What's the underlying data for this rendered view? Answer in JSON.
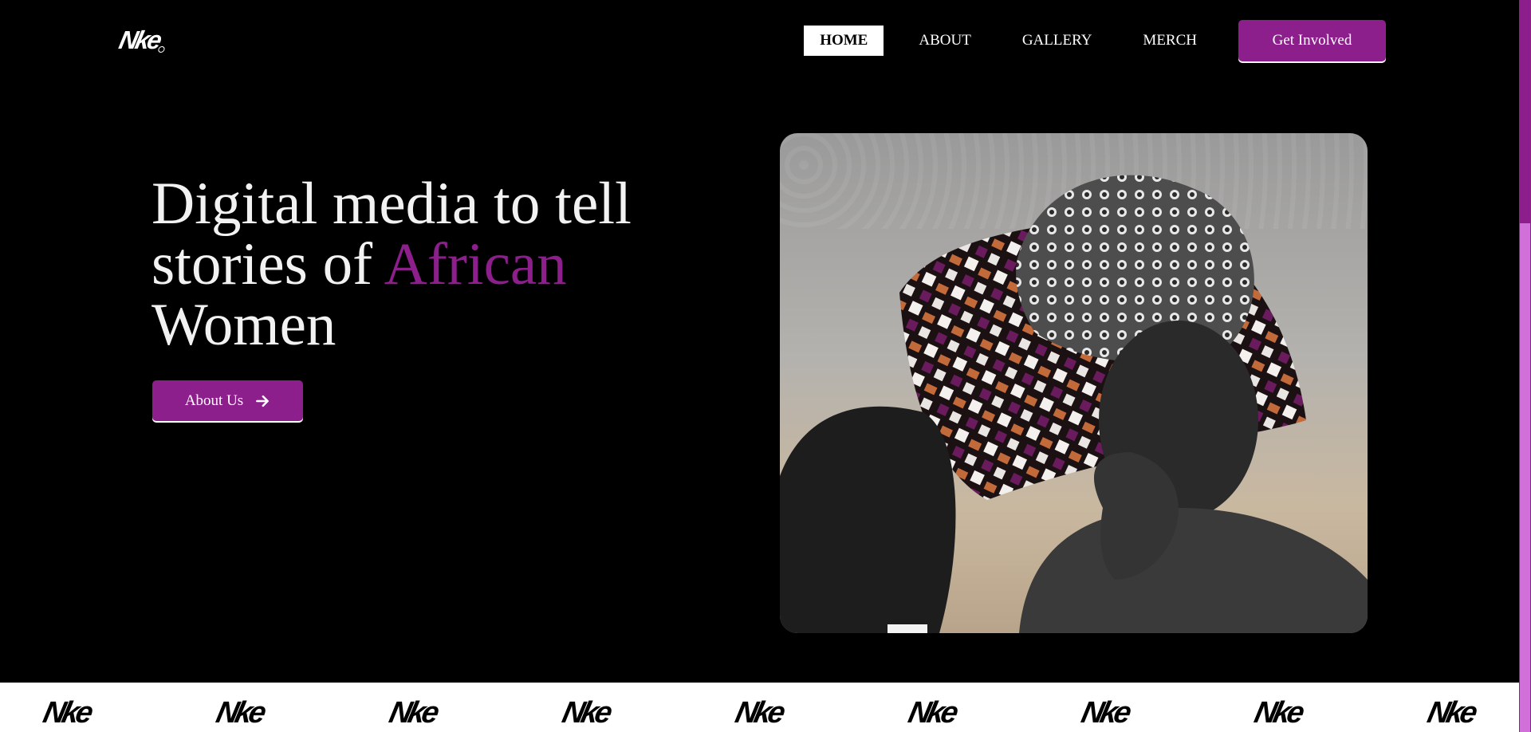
{
  "brand": {
    "logo_text": "Nke"
  },
  "nav": {
    "items": [
      {
        "label": "HOME",
        "active": true
      },
      {
        "label": "ABOUT",
        "active": false
      },
      {
        "label": "GALLERY",
        "active": false
      },
      {
        "label": "MERCH",
        "active": false
      }
    ],
    "cta_label": "Get Involved"
  },
  "hero": {
    "title_part1": "Digital media to tell stories of ",
    "title_accent": "African",
    "title_part2": " Women",
    "button_label": "About Us",
    "button_icon": "arrow-right-icon",
    "image_subject": "two women wearing patterned head wraps"
  },
  "marquee": {
    "logo_text": "Nke",
    "repeat": 9
  },
  "colors": {
    "background": "#000000",
    "accent": "#8d1f8c",
    "text": "#ffffff",
    "marquee_bg": "#ffffff",
    "scrollbar_track": "#7c2c84",
    "scrollbar_thumb": "#d070d8"
  }
}
